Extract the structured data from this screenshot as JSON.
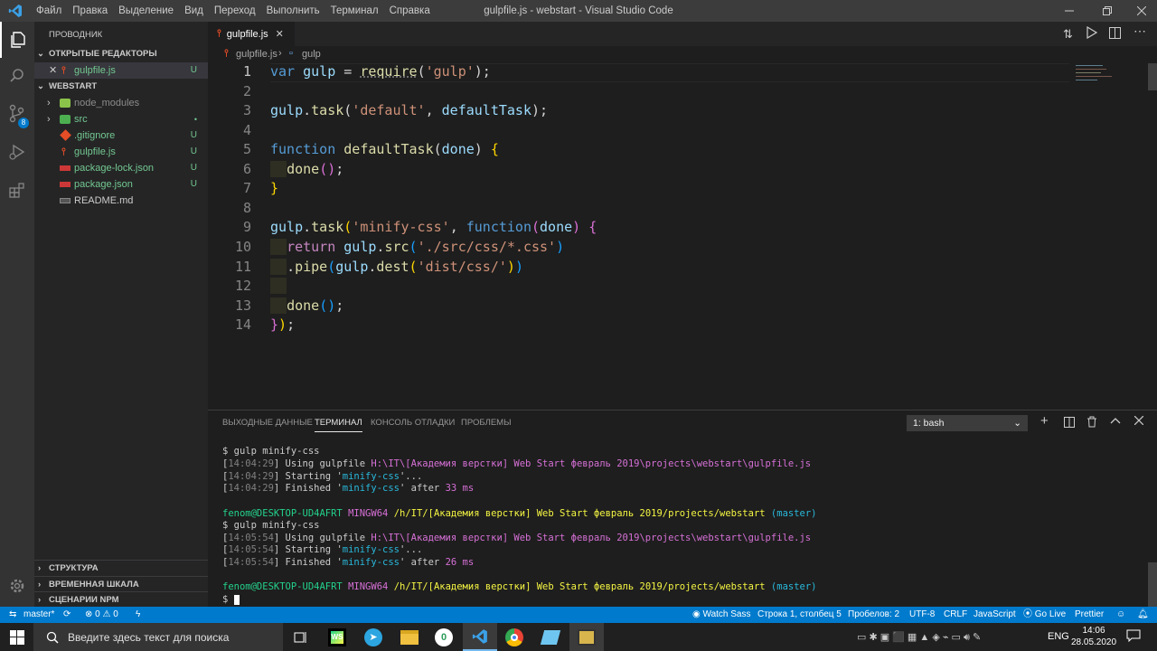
{
  "titlebar": {
    "menu": [
      "Файл",
      "Правка",
      "Выделение",
      "Вид",
      "Переход",
      "Выполнить",
      "Терминал",
      "Справка"
    ],
    "title": "gulpfile.js - webstart - Visual Studio Code"
  },
  "sidebar": {
    "header": "ПРОВОДНИК",
    "open_editors": "ОТКРЫТЫЕ РЕДАКТОРЫ",
    "open_file": "gulpfile.js",
    "open_file_status": "U",
    "project": "WEBSTART",
    "items": [
      {
        "name": "node_modules",
        "status": ""
      },
      {
        "name": "src",
        "status": "•"
      },
      {
        "name": ".gitignore",
        "status": "U"
      },
      {
        "name": "gulpfile.js",
        "status": "U"
      },
      {
        "name": "package-lock.json",
        "status": "U"
      },
      {
        "name": "package.json",
        "status": "U"
      },
      {
        "name": "README.md",
        "status": ""
      }
    ],
    "outline": "СТРУКТУРА",
    "timeline": "ВРЕМЕННАЯ ШКАЛА",
    "npm": "СЦЕНАРИИ NPM",
    "git_badge": "8"
  },
  "editor": {
    "tab": "gulpfile.js",
    "breadcrumb": [
      "gulpfile.js",
      "gulp"
    ],
    "line_numbers": [
      "1",
      "2",
      "3",
      "4",
      "5",
      "6",
      "7",
      "8",
      "9",
      "10",
      "11",
      "12",
      "13",
      "14"
    ]
  },
  "panel": {
    "tabs": [
      "ВЫХОДНЫЕ ДАННЫЕ",
      "ТЕРМИНАЛ",
      "КОНСОЛЬ ОТЛАДКИ",
      "ПРОБЛЕМЫ"
    ],
    "terminal_select": "1: bash"
  },
  "status": {
    "branch": "master*",
    "problems": "⊗ 0 ⚠ 0",
    "watch_sass": "Watch Sass",
    "position": "Строка 1, столбец 5",
    "spaces": "Пробелов: 2",
    "encoding": "UTF-8",
    "eol": "CRLF",
    "language": "JavaScript",
    "golive": "Go Live",
    "prettier": "Prettier"
  },
  "taskbar": {
    "search_placeholder": "Введите здесь текст для поиска",
    "lang": "ENG",
    "time": "14:06",
    "date": "28.05.2020"
  },
  "colors": {
    "accent": "#007acc",
    "keyword": "#569cd6",
    "string": "#ce9178",
    "function": "#dcdcaa",
    "variable": "#9cdcfe",
    "git_added": "#73c991"
  }
}
